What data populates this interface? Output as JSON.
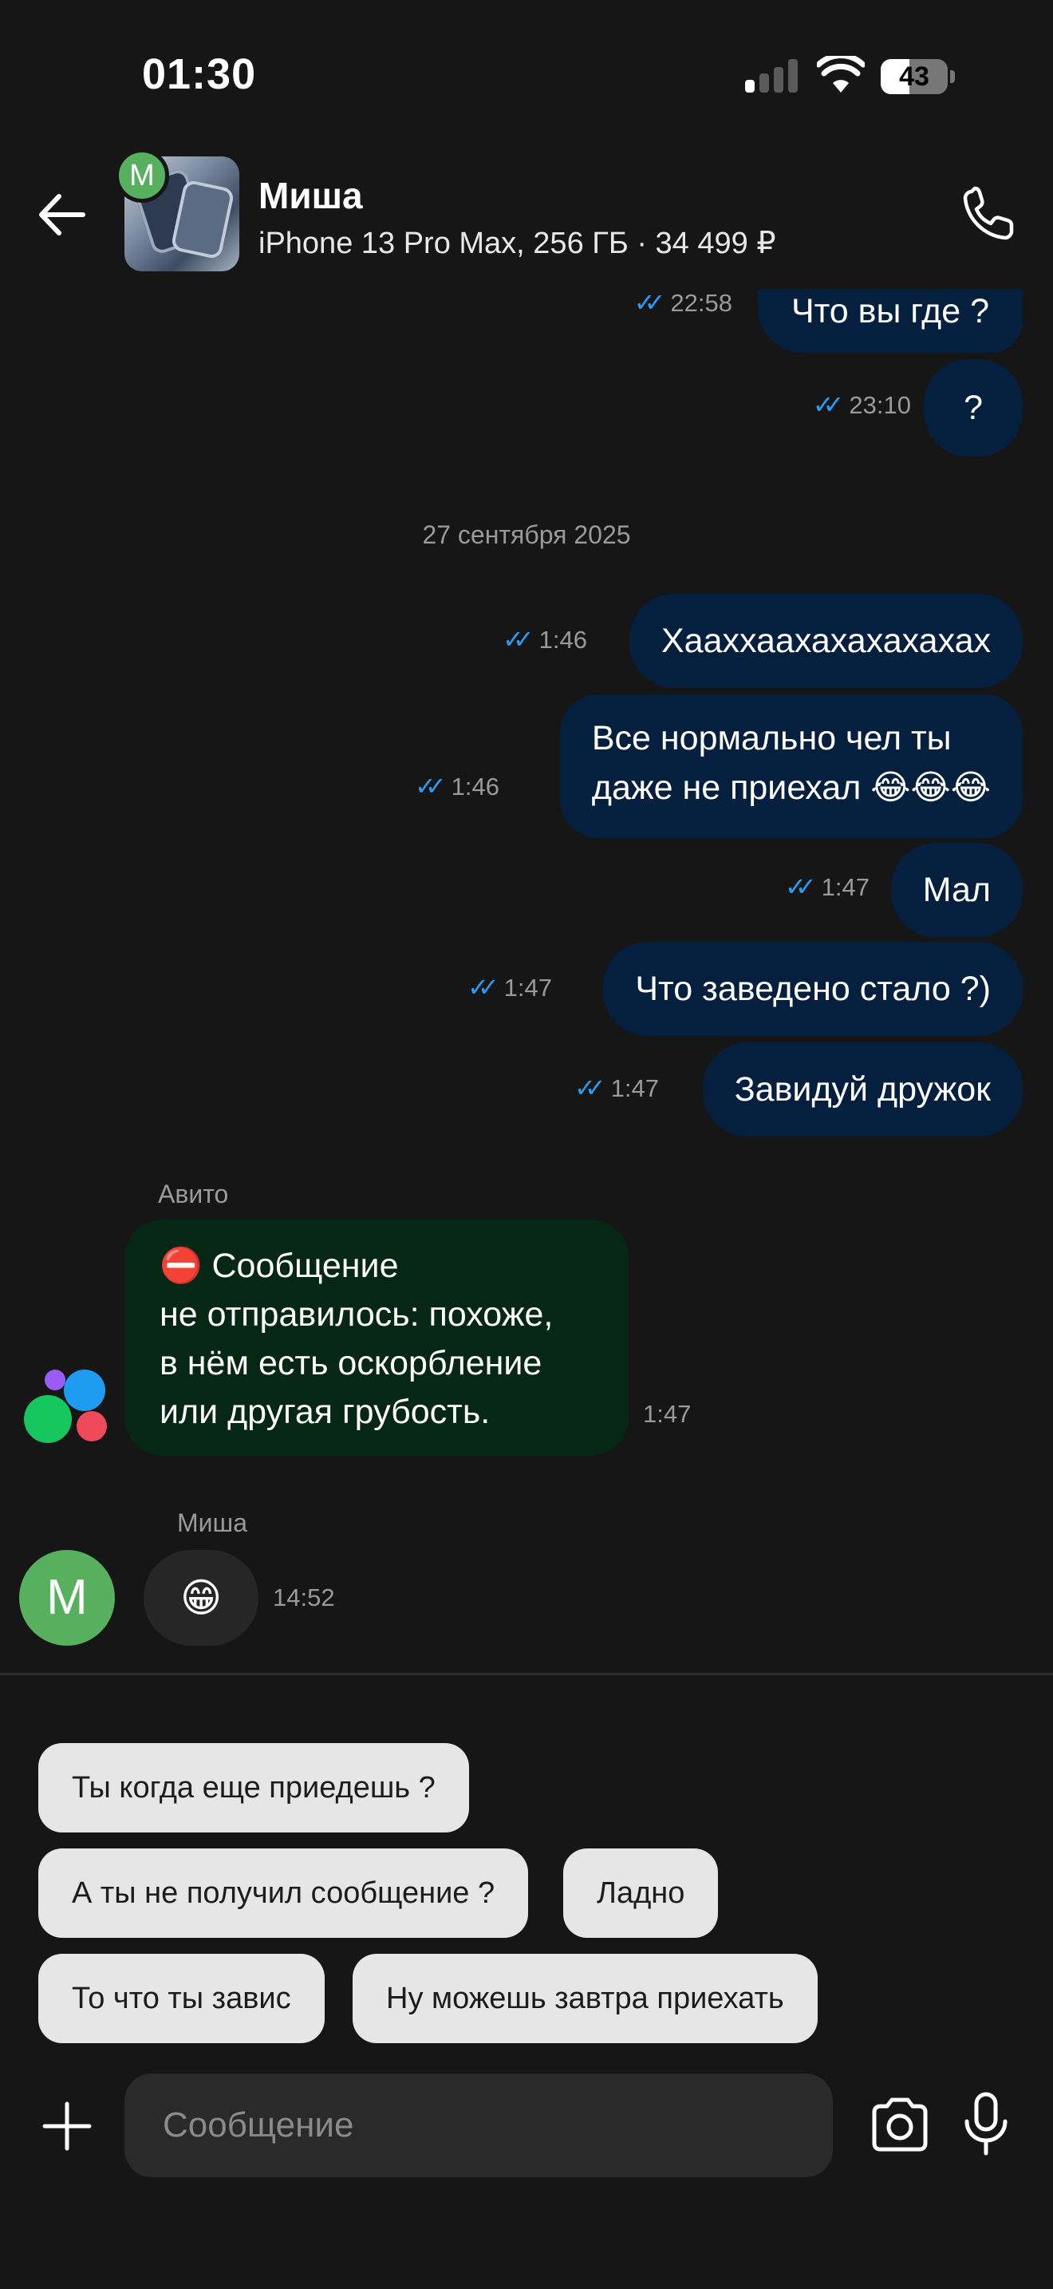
{
  "status_bar": {
    "time": "01:30",
    "battery_level": "43",
    "battery_fraction": 0.43,
    "signal_bars_active": 1,
    "signal_bars_total": 4
  },
  "header": {
    "contact_initial": "M",
    "contact_name": "Миша",
    "subtitle": "iPhone 13 Pro Max, 256 ГБ · 34 499 ₽"
  },
  "ticks_glyph": "✓✓",
  "messages": [
    {
      "text": "Что вы где ?",
      "time": "22:58"
    },
    {
      "text": "?",
      "time": "23:10"
    },
    {
      "text": "Хааххаахахахахахах",
      "time": "1:46"
    },
    {
      "line1": "Все нормально чел ты",
      "line2": "даже не приехал 😂😂😂",
      "time": "1:46"
    },
    {
      "text": "Мал",
      "time": "1:47"
    },
    {
      "text": "Что заведено стало ?)",
      "time": "1:47"
    },
    {
      "text": "Завидуй дружок",
      "time": "1:47"
    }
  ],
  "date_separator": "27 сентября 2025",
  "system_message": {
    "sender": "Авито",
    "lines": [
      "⛔ Сообщение",
      "не отправилось: похоже,",
      "в нём есть оскорбление",
      "или другая грубость."
    ],
    "time": "1:47"
  },
  "incoming_message": {
    "sender": "Миша",
    "avatar_initial": "M",
    "emoji": "😁",
    "time": "14:52"
  },
  "quick_replies": [
    "Ты когда еще приедешь ?",
    "А ты не получил сообщение ?",
    "Ладно",
    "То что ты завис",
    "Ну можешь завтра приехать"
  ],
  "composer": {
    "placeholder": "Сообщение"
  },
  "colors": {
    "background": "#161616",
    "outgoing_bubble": "#05203f",
    "system_bubble": "#052713",
    "read_ticks": "#2a9bf3",
    "avatar_green": "#57b05e",
    "chip_background": "#e6e6e6"
  },
  "icons": {
    "back": "arrow-left-icon",
    "call": "phone-icon",
    "add": "plus-icon",
    "camera": "camera-icon",
    "microphone": "microphone-icon"
  }
}
